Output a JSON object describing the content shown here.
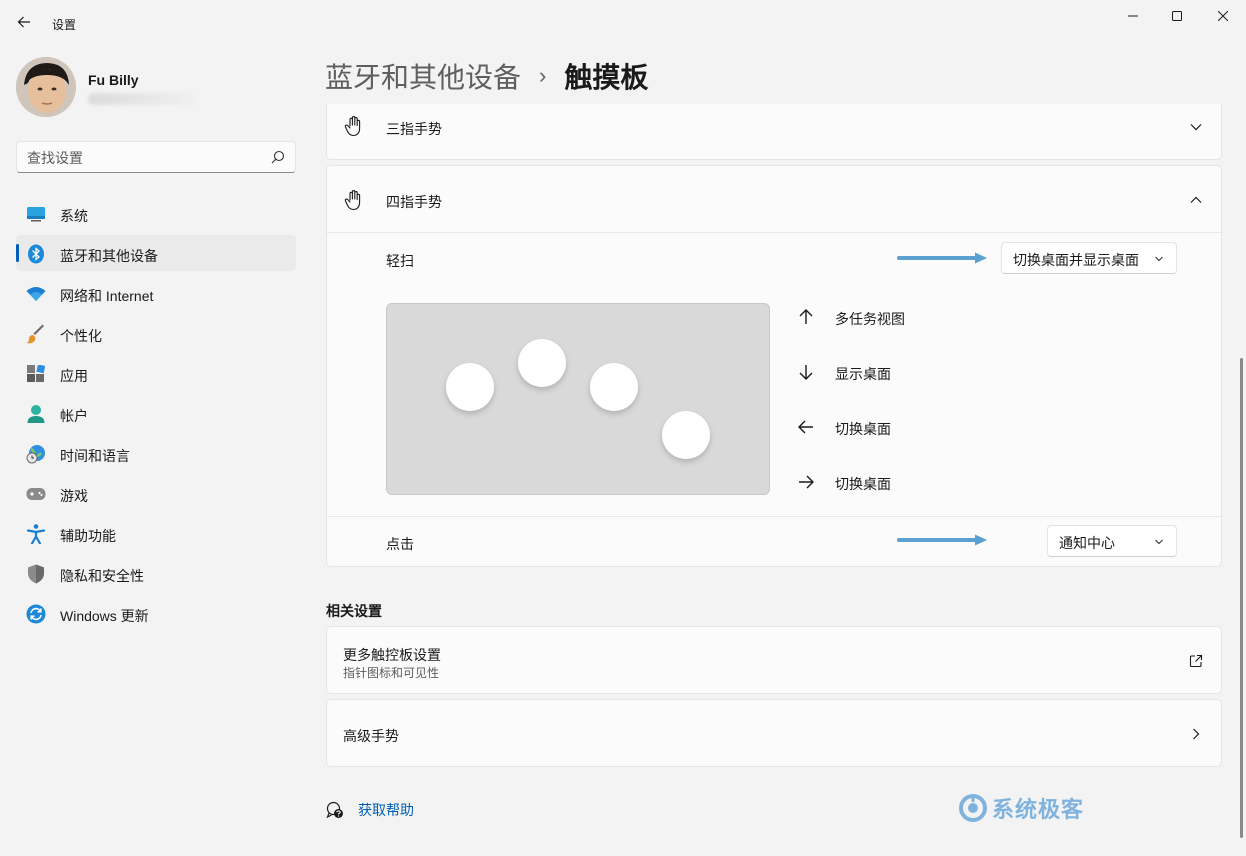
{
  "window": {
    "title": "设置"
  },
  "profile": {
    "name": "Fu Billy"
  },
  "search": {
    "placeholder": "查找设置"
  },
  "sidebar": {
    "items": [
      {
        "label": "系统",
        "icon": "monitor-icon"
      },
      {
        "label": "蓝牙和其他设备",
        "icon": "bluetooth-icon",
        "active": true
      },
      {
        "label": "网络和 Internet",
        "icon": "wifi-icon"
      },
      {
        "label": "个性化",
        "icon": "brush-icon"
      },
      {
        "label": "应用",
        "icon": "apps-icon"
      },
      {
        "label": "帐户",
        "icon": "person-icon"
      },
      {
        "label": "时间和语言",
        "icon": "globe-clock-icon"
      },
      {
        "label": "游戏",
        "icon": "gamepad-icon"
      },
      {
        "label": "辅助功能",
        "icon": "accessibility-icon"
      },
      {
        "label": "隐私和安全性",
        "icon": "shield-icon"
      },
      {
        "label": "Windows 更新",
        "icon": "update-icon"
      }
    ]
  },
  "breadcrumb": {
    "parent": "蓝牙和其他设备",
    "separator": "›",
    "current": "触摸板"
  },
  "three_finger": {
    "title": "三指手势",
    "expanded": false
  },
  "four_finger": {
    "title": "四指手势",
    "expanded": true,
    "swipe": {
      "label": "轻扫",
      "value": "切换桌面并显示桌面"
    },
    "gestures": [
      {
        "direction": "up",
        "label": "多任务视图"
      },
      {
        "direction": "down",
        "label": "显示桌面"
      },
      {
        "direction": "left",
        "label": "切换桌面"
      },
      {
        "direction": "right",
        "label": "切换桌面"
      }
    ],
    "tap": {
      "label": "点击",
      "value": "通知中心"
    }
  },
  "related": {
    "title": "相关设置",
    "more": {
      "title": "更多触控板设置",
      "subtitle": "指针图标和可见性"
    },
    "advanced": {
      "title": "高级手势"
    }
  },
  "help": {
    "label": "获取帮助"
  },
  "watermark": {
    "text": "系统极客"
  },
  "colors": {
    "accent": "#005fb8",
    "callout_arrow": "#5aa0d0"
  }
}
